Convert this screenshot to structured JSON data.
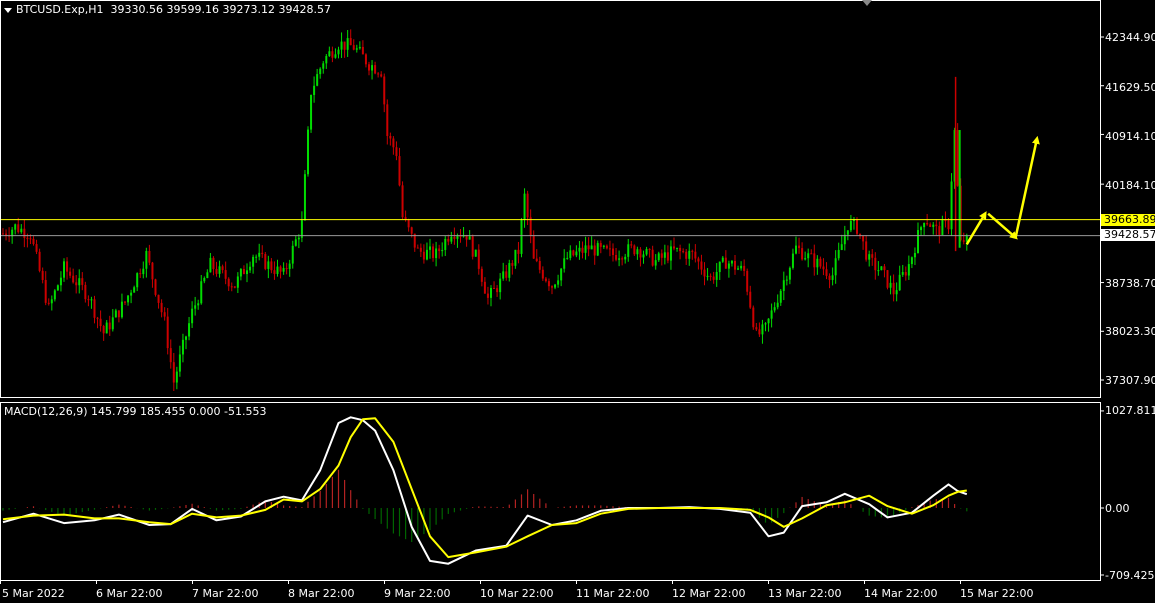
{
  "header": {
    "symbol": "BTCUSD.Exp,H1",
    "ohlc": "39330.56 39599.16 39273.12 39428.57"
  },
  "macd": {
    "label": "MACD(12,26,9) 145.799 185.455 0.000 -51.553",
    "axis_labels": [
      "1027.811",
      "0.00",
      "-709.425"
    ]
  },
  "price_axis": {
    "labels": [
      "42344.90",
      "41629.50",
      "40914.10",
      "40184.10",
      "38738.70",
      "38023.30",
      "37307.90"
    ],
    "levels": [
      42344.9,
      41629.5,
      40914.1,
      40184.1,
      38738.7,
      38023.3,
      37307.9
    ]
  },
  "price_tags": {
    "resistance": "39663.89",
    "current": "39428.57"
  },
  "time_axis": {
    "labels": [
      "5 Mar 2022",
      "6 Mar 22:00",
      "7 Mar 22:00",
      "8 Mar 22:00",
      "9 Mar 22:00",
      "10 Mar 22:00",
      "11 Mar 22:00",
      "12 Mar 22:00",
      "13 Mar 22:00",
      "14 Mar 22:00",
      "15 Mar 22:00"
    ]
  },
  "colors": {
    "background": "#000000",
    "bull": "#00dd00",
    "bear": "#cc0000",
    "level_line": "#ffff00",
    "current_line": "#9a9a9a",
    "macd_line": "#ffffff",
    "signal_line": "#ffff00",
    "hist_pos": "#b22222",
    "hist_neg": "#006400",
    "arrow": "#ffff00",
    "frame": "#ffffff"
  },
  "chart_data": {
    "type": "candlestick",
    "timeframe": "H1",
    "price_range": [
      37000,
      42900
    ],
    "resistance_level": 39663.89,
    "current_price": 39428.57,
    "close_path": [
      {
        "bar": 0,
        "price": 39460
      },
      {
        "bar": 4,
        "price": 39560
      },
      {
        "bar": 9,
        "price": 39450
      },
      {
        "bar": 15,
        "price": 38350
      },
      {
        "bar": 20,
        "price": 38950
      },
      {
        "bar": 28,
        "price": 38550
      },
      {
        "bar": 33,
        "price": 38000
      },
      {
        "bar": 40,
        "price": 38450
      },
      {
        "bar": 47,
        "price": 39150
      },
      {
        "bar": 53,
        "price": 38150
      },
      {
        "bar": 56,
        "price": 37280
      },
      {
        "bar": 62,
        "price": 38300
      },
      {
        "bar": 68,
        "price": 39000
      },
      {
        "bar": 76,
        "price": 38700
      },
      {
        "bar": 82,
        "price": 39150
      },
      {
        "bar": 92,
        "price": 38850
      },
      {
        "bar": 98,
        "price": 39600
      },
      {
        "bar": 101,
        "price": 41550
      },
      {
        "bar": 105,
        "price": 42000
      },
      {
        "bar": 110,
        "price": 42250
      },
      {
        "bar": 115,
        "price": 42200
      },
      {
        "bar": 120,
        "price": 41950
      },
      {
        "bar": 124,
        "price": 41850
      },
      {
        "bar": 126,
        "price": 40900
      },
      {
        "bar": 129,
        "price": 40650
      },
      {
        "bar": 131,
        "price": 39700
      },
      {
        "bar": 136,
        "price": 39200
      },
      {
        "bar": 142,
        "price": 39150
      },
      {
        "bar": 147,
        "price": 39500
      },
      {
        "bar": 152,
        "price": 39450
      },
      {
        "bar": 156,
        "price": 39000
      },
      {
        "bar": 159,
        "price": 38500
      },
      {
        "bar": 164,
        "price": 38800
      },
      {
        "bar": 169,
        "price": 39200
      },
      {
        "bar": 171,
        "price": 40000
      },
      {
        "bar": 174,
        "price": 39050
      },
      {
        "bar": 180,
        "price": 38700
      },
      {
        "bar": 185,
        "price": 39100
      },
      {
        "bar": 192,
        "price": 39250
      },
      {
        "bar": 200,
        "price": 39150
      },
      {
        "bar": 208,
        "price": 39250
      },
      {
        "bar": 214,
        "price": 39050
      },
      {
        "bar": 220,
        "price": 39200
      },
      {
        "bar": 226,
        "price": 39150
      },
      {
        "bar": 232,
        "price": 38800
      },
      {
        "bar": 237,
        "price": 39050
      },
      {
        "bar": 243,
        "price": 38900
      },
      {
        "bar": 247,
        "price": 37950
      },
      {
        "bar": 250,
        "price": 38050
      },
      {
        "bar": 255,
        "price": 38650
      },
      {
        "bar": 260,
        "price": 39250
      },
      {
        "bar": 266,
        "price": 39050
      },
      {
        "bar": 272,
        "price": 38850
      },
      {
        "bar": 277,
        "price": 39600
      },
      {
        "bar": 280,
        "price": 39550
      },
      {
        "bar": 284,
        "price": 39050
      },
      {
        "bar": 288,
        "price": 38900
      },
      {
        "bar": 292,
        "price": 38600
      },
      {
        "bar": 297,
        "price": 39000
      },
      {
        "bar": 302,
        "price": 39700
      },
      {
        "bar": 306,
        "price": 39500
      },
      {
        "bar": 310,
        "price": 39600
      },
      {
        "bar": 312,
        "price": 40950
      },
      {
        "bar": 314,
        "price": 39300
      },
      {
        "bar": 316,
        "price": 39428
      }
    ],
    "forecast_arrows": [
      {
        "from_bar": 316,
        "from_price": 39300,
        "to_bar": 322,
        "to_price": 39750
      },
      {
        "from_bar": 323,
        "from_price": 39750,
        "to_bar": 332,
        "to_price": 39400
      },
      {
        "from_bar": 332,
        "from_price": 39400,
        "to_bar": 339,
        "to_price": 40850
      }
    ],
    "macd_range": [
      -709.425,
      1027.811
    ],
    "macd_path": [
      {
        "bar": 0,
        "macd": -150,
        "signal": -120
      },
      {
        "bar": 10,
        "macd": -60,
        "signal": -80
      },
      {
        "bar": 20,
        "macd": -160,
        "signal": -70
      },
      {
        "bar": 30,
        "macd": -130,
        "signal": -110
      },
      {
        "bar": 38,
        "macd": -70,
        "signal": -110
      },
      {
        "bar": 48,
        "macd": -180,
        "signal": -150
      },
      {
        "bar": 55,
        "macd": -170,
        "signal": -170
      },
      {
        "bar": 62,
        "macd": -10,
        "signal": -60
      },
      {
        "bar": 70,
        "macd": -130,
        "signal": -100
      },
      {
        "bar": 78,
        "macd": -90,
        "signal": -80
      },
      {
        "bar": 86,
        "macd": 70,
        "signal": -20
      },
      {
        "bar": 92,
        "macd": 120,
        "signal": 90
      },
      {
        "bar": 98,
        "macd": 80,
        "signal": 70
      },
      {
        "bar": 104,
        "macd": 400,
        "signal": 200
      },
      {
        "bar": 110,
        "macd": 900,
        "signal": 450
      },
      {
        "bar": 114,
        "macd": 960,
        "signal": 750
      },
      {
        "bar": 118,
        "macd": 930,
        "signal": 940
      },
      {
        "bar": 122,
        "macd": 820,
        "signal": 950
      },
      {
        "bar": 128,
        "macd": 400,
        "signal": 700
      },
      {
        "bar": 134,
        "macd": -200,
        "signal": 200
      },
      {
        "bar": 140,
        "macd": -560,
        "signal": -300
      },
      {
        "bar": 146,
        "macd": -590,
        "signal": -520
      },
      {
        "bar": 155,
        "macd": -450,
        "signal": -470
      },
      {
        "bar": 165,
        "macd": -400,
        "signal": -410
      },
      {
        "bar": 172,
        "macd": -80,
        "signal": -300
      },
      {
        "bar": 180,
        "macd": -180,
        "signal": -180
      },
      {
        "bar": 188,
        "macd": -130,
        "signal": -160
      },
      {
        "bar": 196,
        "macd": -30,
        "signal": -60
      },
      {
        "bar": 205,
        "macd": 0,
        "signal": -10
      },
      {
        "bar": 215,
        "macd": 0,
        "signal": 0
      },
      {
        "bar": 225,
        "macd": 10,
        "signal": 0
      },
      {
        "bar": 235,
        "macd": -10,
        "signal": 0
      },
      {
        "bar": 245,
        "macd": -50,
        "signal": -20
      },
      {
        "bar": 251,
        "macd": -300,
        "signal": -100
      },
      {
        "bar": 256,
        "macd": -260,
        "signal": -200
      },
      {
        "bar": 262,
        "macd": 20,
        "signal": -110
      },
      {
        "bar": 270,
        "macd": 60,
        "signal": 30
      },
      {
        "bar": 276,
        "macd": 150,
        "signal": 60
      },
      {
        "bar": 284,
        "macd": 40,
        "signal": 130
      },
      {
        "bar": 290,
        "macd": -100,
        "signal": 20
      },
      {
        "bar": 298,
        "macd": -50,
        "signal": -60
      },
      {
        "bar": 305,
        "macd": 130,
        "signal": 30
      },
      {
        "bar": 310,
        "macd": 250,
        "signal": 130
      },
      {
        "bar": 313,
        "macd": 180,
        "signal": 170
      },
      {
        "bar": 316,
        "macd": 146,
        "signal": 185
      }
    ]
  }
}
